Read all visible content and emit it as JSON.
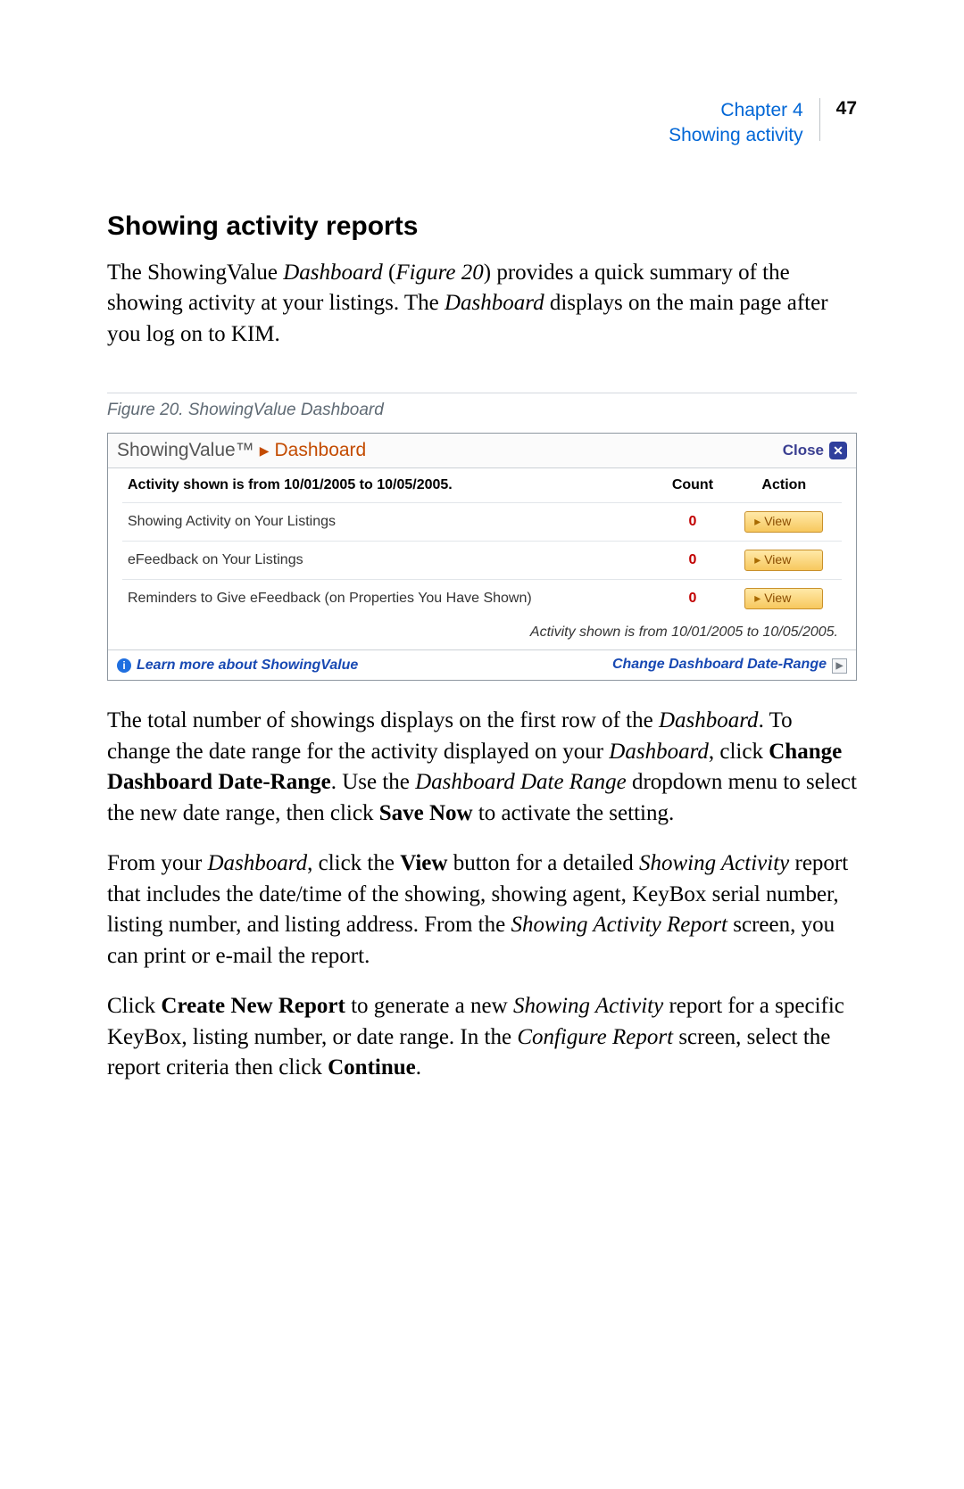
{
  "header": {
    "chapter": "Chapter 4",
    "subtitle": "Showing activity",
    "page_number": "47"
  },
  "section_title": "Showing activity reports",
  "intro": {
    "p1a": "The ShowingValue ",
    "p1b": "Dashboard",
    "p1c": " (",
    "p1d": "Figure 20",
    "p1e": ") provides a quick summary of the showing activity at your listings.  The ",
    "p1f": "Dashboard",
    "p1g": " displays on the main page after you log on to KIM."
  },
  "figure_caption": "Figure 20.  ShowingValue Dashboard",
  "dashboard": {
    "brand": "ShowingValue™",
    "title": "Dashboard",
    "close_label": "Close",
    "header_activity": "Activity shown is from 10/01/2005 to 10/05/2005.",
    "col_count": "Count",
    "col_action": "Action",
    "rows": [
      {
        "label": "Showing Activity on Your Listings",
        "count": "0",
        "action": "View"
      },
      {
        "label": "eFeedback on Your Listings",
        "count": "0",
        "action": "View"
      },
      {
        "label": "Reminders to Give eFeedback (on Properties You Have Shown)",
        "count": "0",
        "action": "View"
      }
    ],
    "footer_note": "Activity shown is from 10/01/2005 to 10/05/2005.",
    "learn_more": "Learn more about ShowingValue",
    "change_range": "Change Dashboard Date-Range"
  },
  "body": {
    "p2a": "The total number of showings displays on the first row of the ",
    "p2b": "Dashboard",
    "p2c": ".  To change the date range for the activity displayed on your ",
    "p2d": "Dashboard",
    "p2e": ", click ",
    "p2f": "Change Dashboard Date-Range",
    "p2g": ".  Use the ",
    "p2h": "Dashboard Date Range",
    "p2i": " dropdown menu to select the new date range, then click ",
    "p2j": "Save Now",
    "p2k": " to activate the setting.",
    "p3a": "From your ",
    "p3b": "Dashboard",
    "p3c": ", click the ",
    "p3d": "View",
    "p3e": " button for a detailed ",
    "p3f": "Showing Activity",
    "p3g": " report that includes the date/time of the showing, showing agent, KeyBox serial number, listing number, and listing address.  From the ",
    "p3h": "Showing Activity Report",
    "p3i": " screen, you can print or e-mail the report.",
    "p4a": "Click ",
    "p4b": "Create New Report",
    "p4c": " to generate a new ",
    "p4d": "Showing Activity",
    "p4e": " report for a specific KeyBox, listing number, or date range.  In the ",
    "p4f": "Configure Report",
    "p4g": " screen, select the report criteria then click ",
    "p4h": "Continue",
    "p4i": "."
  }
}
